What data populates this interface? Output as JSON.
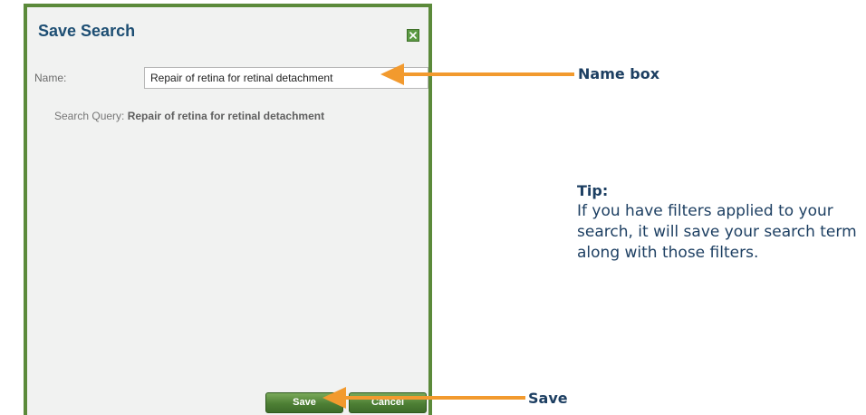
{
  "dialog": {
    "title": "Save Search",
    "close_icon": "close-icon",
    "name_label": "Name:",
    "name_value": "Repair of retina for retinal detachment",
    "query_label": "Search Query:",
    "query_value": "Repair of retina for retinal detachment",
    "save_label": "Save",
    "cancel_label": "Cancel"
  },
  "annotations": {
    "name_box_label": "Name box",
    "save_label": "Save",
    "tip_heading": "Tip:",
    "tip_body": "If you have filters applied to your search, it will save your search term along with those filters."
  },
  "colors": {
    "dialog_border": "#5b8a3a",
    "dialog_background": "#f1f2f1",
    "title_text": "#1d4e73",
    "button_green": "#4d7f34",
    "arrow_orange": "#f29a2e",
    "annotation_text": "#1d3f62"
  }
}
